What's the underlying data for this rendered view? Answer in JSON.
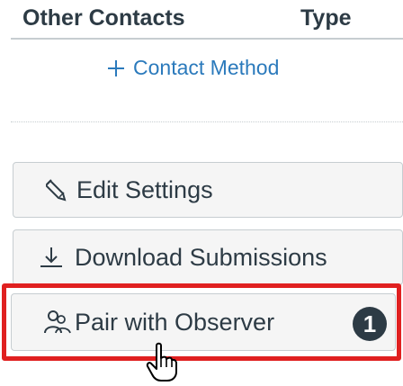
{
  "table": {
    "headers": {
      "contacts": "Other Contacts",
      "type": "Type"
    }
  },
  "add_contact_label": "Contact Method",
  "actions": [
    {
      "label": "Edit Settings",
      "icon": "pencil-icon"
    },
    {
      "label": "Download Submissions",
      "icon": "download-icon"
    },
    {
      "label": "Pair with Observer",
      "icon": "pair-observer-icon"
    }
  ],
  "callout": {
    "step_number": "1",
    "highlight_color": "#e02020"
  },
  "colors": {
    "text": "#2d3b45",
    "link": "#2b7abc",
    "button_bg": "#f5f5f5",
    "border": "#c7cdd1"
  },
  "cursor": "pointer-hand-icon"
}
